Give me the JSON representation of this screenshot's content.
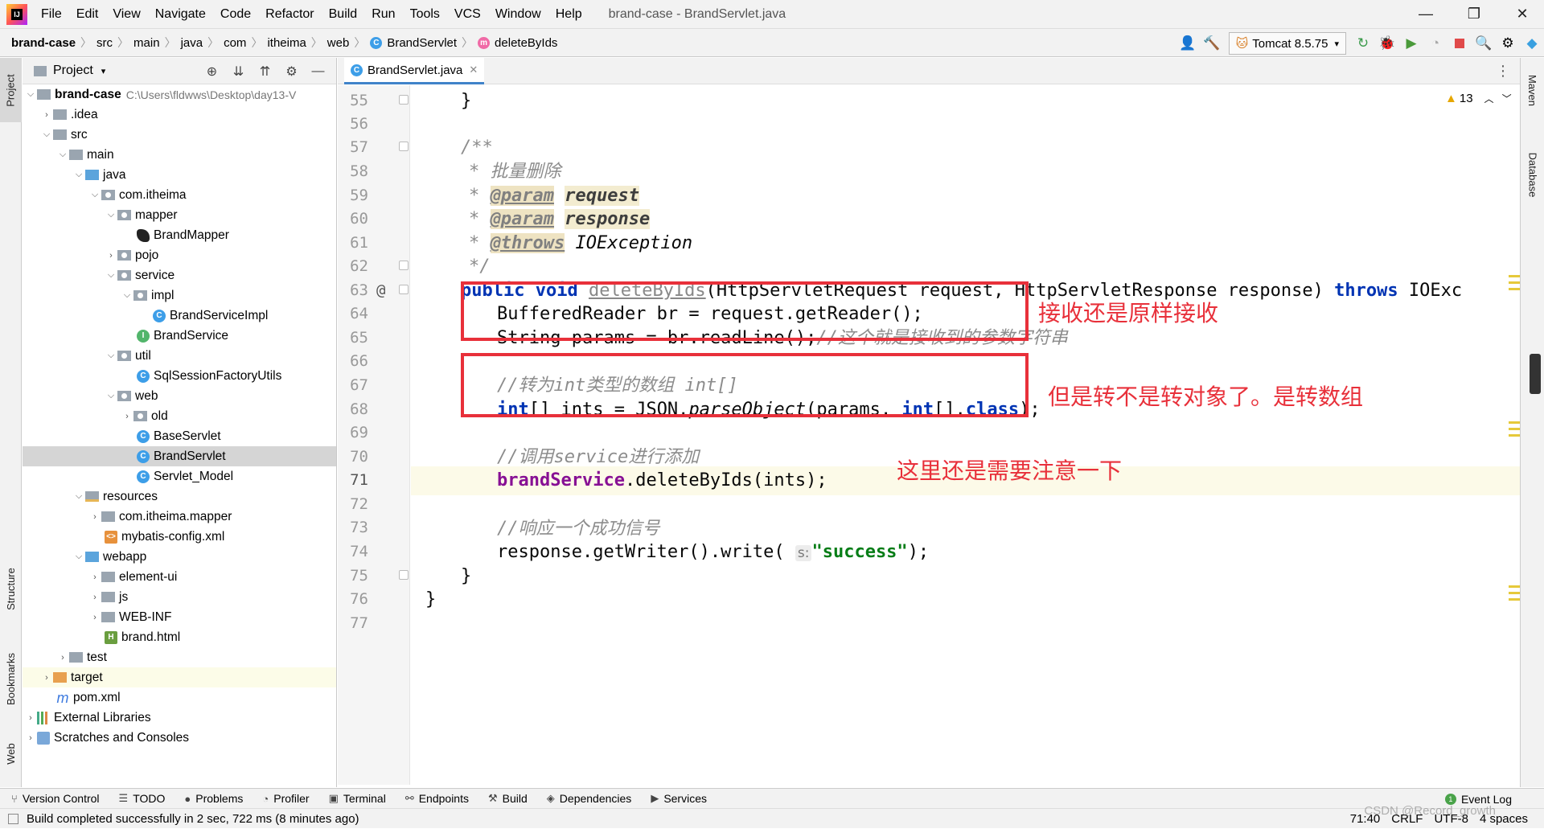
{
  "menubar": {
    "items": [
      "File",
      "Edit",
      "View",
      "Navigate",
      "Code",
      "Refactor",
      "Build",
      "Run",
      "Tools",
      "VCS",
      "Window",
      "Help"
    ],
    "title": "brand-case - BrandServlet.java"
  },
  "breadcrumb": {
    "items": [
      "brand-case",
      "src",
      "main",
      "java",
      "com",
      "itheima",
      "web",
      "BrandServlet",
      "deleteByIds"
    ]
  },
  "toolbar": {
    "run_config": "Tomcat 8.5.75"
  },
  "project_panel": {
    "title": "Project",
    "root_name": "brand-case",
    "root_path": "C:\\Users\\fldwws\\Desktop\\day13-V",
    "tree": [
      "brand-case",
      ".idea",
      "src",
      "main",
      "java",
      "com.itheima",
      "mapper",
      "BrandMapper",
      "pojo",
      "service",
      "impl",
      "BrandServiceImpl",
      "BrandService",
      "util",
      "SqlSessionFactoryUtils",
      "web",
      "old",
      "BaseServlet",
      "BrandServlet",
      "Servlet_Model",
      "resources",
      "com.itheima.mapper",
      "mybatis-config.xml",
      "webapp",
      "element-ui",
      "js",
      "WEB-INF",
      "brand.html",
      "test",
      "target",
      "pom.xml",
      "External Libraries",
      "Scratches and Consoles"
    ]
  },
  "editor": {
    "tab": "BrandServlet.java",
    "warnings": "13",
    "line_numbers": [
      "55",
      "56",
      "57",
      "58",
      "59",
      "60",
      "61",
      "62",
      "63",
      "64",
      "65",
      "66",
      "67",
      "68",
      "69",
      "70",
      "71",
      "72",
      "73",
      "74",
      "75",
      "76",
      "77"
    ],
    "code": {
      "l55": "}",
      "l57": "/**",
      "l58_star": "*",
      "l58_text": "批量删除",
      "l59_star": "*",
      "l59_tag": "@param",
      "l59_param": "request",
      "l60_star": "*",
      "l60_tag": "@param",
      "l60_param": "response",
      "l61_star": "*",
      "l61_tag": "@throws",
      "l61_param": "IOException",
      "l62": "*/",
      "l63_kw1": "public",
      "l63_kw2": "void",
      "l63_name": "deleteByIds",
      "l63_rest": "(HttpServletRequest request, HttpServletResponse response)",
      "l63_throws": "throws",
      "l63_tail": "IOExc",
      "l64": "BufferedReader br = request.getReader();",
      "l65_code": "String params = br.readLine();",
      "l65_comment": "//这个就是接收到的参数字符串",
      "l67": "//转为int类型的数组 int[]",
      "l68_kw": "int",
      "l68_a": "[] ints = JSON.",
      "l68_m": "parseObject",
      "l68_b": "(params, ",
      "l68_kw2": "int",
      "l68_c": "[].",
      "l68_kw3": "class",
      "l68_d": ");",
      "l70": "//调用service进行添加",
      "l71_field": "brandService",
      "l71_rest": ".deleteByIds(ints);",
      "l73": "//响应一个成功信号",
      "l74_a": "response.getWriter().write(",
      "l74_hint": "s:",
      "l74_str": "\"success\"",
      "l74_b": ");",
      "l75": "}",
      "l76": "}"
    },
    "annotations": {
      "a1": "接收还是原样接收",
      "a2": "但是转不是转对象了。是转数组",
      "a3": "这里还是需要注意一下"
    }
  },
  "bottom_tools": [
    "Version Control",
    "TODO",
    "Problems",
    "Profiler",
    "Terminal",
    "Endpoints",
    "Build",
    "Dependencies",
    "Services"
  ],
  "event_log": "Event Log",
  "status": {
    "message": "Build completed successfully in 2 sec, 722 ms (8 minutes ago)",
    "position": "71:40",
    "line_sep": "CRLF",
    "encoding": "UTF-8",
    "indent": "4 spaces",
    "watermark": "CSDN @Record_growth"
  },
  "side_tabs": {
    "left": [
      "Project",
      "Structure",
      "Bookmarks",
      "Web"
    ],
    "right": [
      "Maven",
      "Database"
    ]
  },
  "colors": {
    "annotation_red": "#e8303a",
    "keyword": "#0033b3",
    "string": "#067d17",
    "field": "#871094"
  }
}
